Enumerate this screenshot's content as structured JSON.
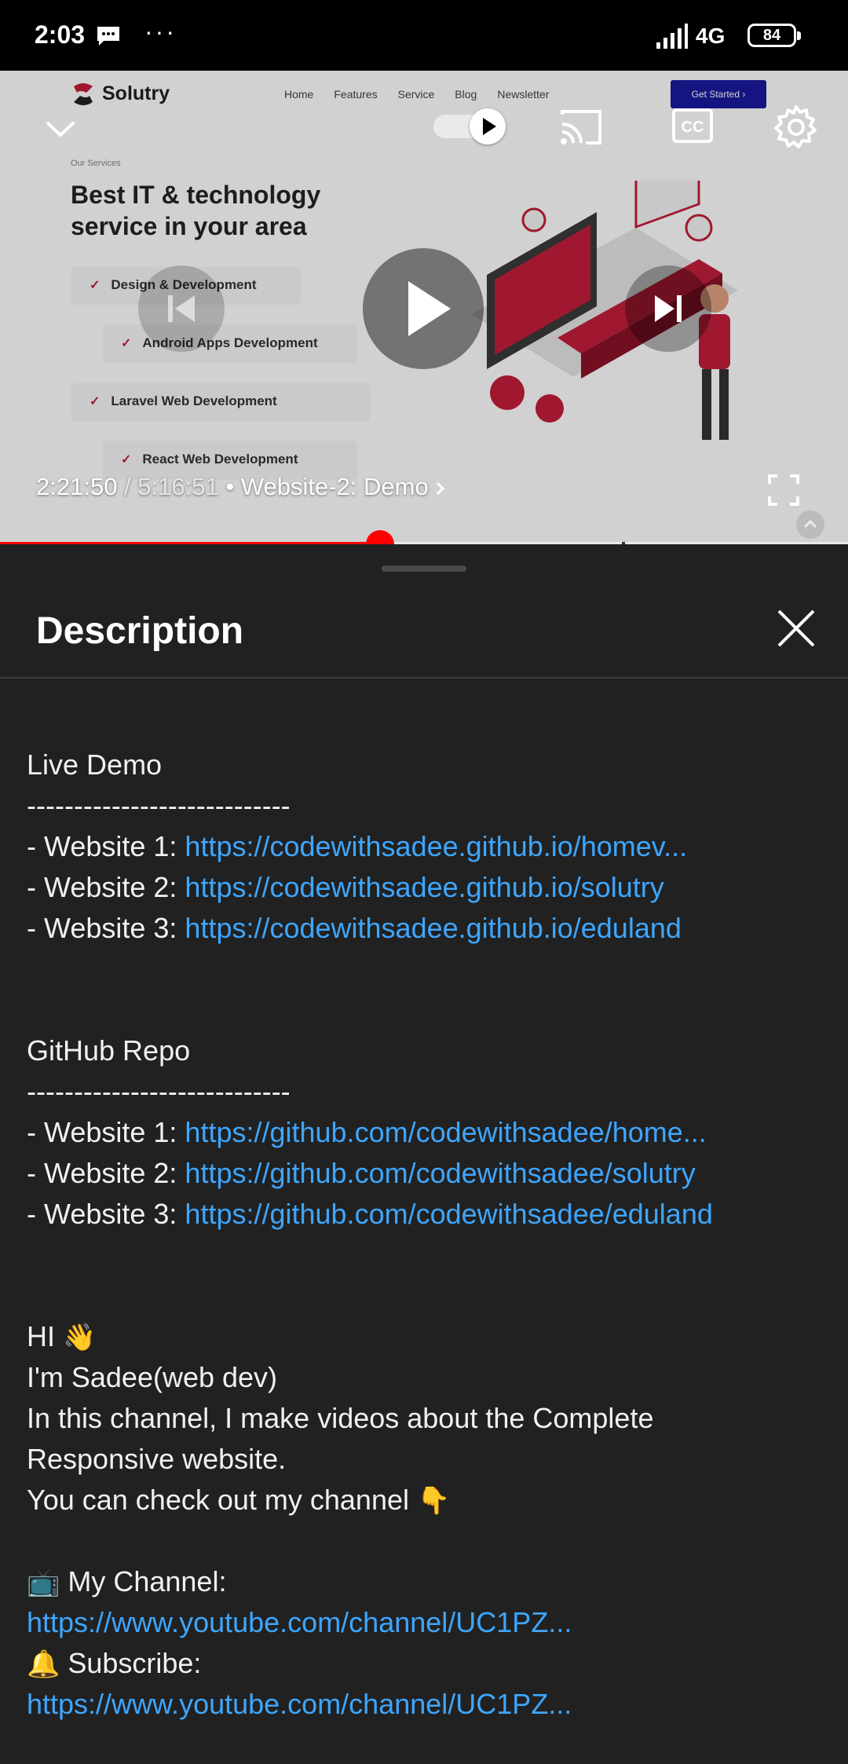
{
  "status_bar": {
    "time": "2:03",
    "more": "···",
    "network": "4G",
    "battery": "84"
  },
  "video": {
    "site": {
      "logo_text": "Solutry",
      "nav_links": [
        "Home",
        "Features",
        "Service",
        "Blog",
        "Newsletter"
      ],
      "cta": "Get Started ›",
      "eyebrow": "Our Services",
      "heading": "Best IT & technology service in your area",
      "services": [
        "Design & Development",
        "Android Apps Development",
        "Laravel Web Development",
        "React Web Development"
      ]
    },
    "current_time": "2:21:50",
    "separator": " / ",
    "duration": "5:16:51",
    "chapter": " • Website-2: Demo",
    "progress_fraction": 0.448,
    "accent_color": "#ff0000"
  },
  "panel": {
    "title": "Description",
    "sections": {
      "live_demo_title": "Live Demo",
      "divider": "----------------------------",
      "live_demo": [
        {
          "label": "- Website 1: ",
          "url": "https://codewithsadee.github.io/homev..."
        },
        {
          "label": "- Website 2: ",
          "url": "https://codewithsadee.github.io/solutry"
        },
        {
          "label": "- Website 3: ",
          "url": "https://codewithsadee.github.io/eduland"
        }
      ],
      "github_title": "GitHub Repo",
      "github": [
        {
          "label": "- Website 1: ",
          "url": "https://github.com/codewithsadee/home..."
        },
        {
          "label": "- Website 2: ",
          "url": "https://github.com/codewithsadee/solutry"
        },
        {
          "label": "- Website 3: ",
          "url": "https://github.com/codewithsadee/eduland"
        }
      ],
      "greeting": "HI ",
      "greeting_emoji": "👋",
      "intro": "I'm Sadee(web dev)",
      "about_1": "In this channel, I make videos about the Complete",
      "about_2": "Responsive website.",
      "check_out": "You can check out my channel ",
      "check_out_emoji": "👇",
      "channel_emoji": "📺",
      "channel_label": " My Channel:",
      "channel_url": "https://www.youtube.com/channel/UC1PZ...",
      "subscribe_emoji": "🔔",
      "subscribe_label": " Subscribe:",
      "subscribe_url": "https://www.youtube.com/channel/UC1PZ..."
    },
    "link_color": "#3ea6ff"
  }
}
